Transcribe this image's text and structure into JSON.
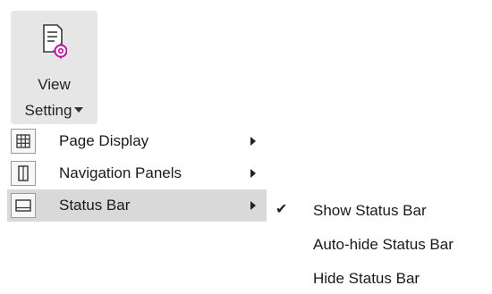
{
  "ribbon": {
    "view_setting": {
      "label_line1": "View",
      "label_line2": "Setting",
      "icon": "document-gear-icon",
      "accent_color": "#b5179e"
    }
  },
  "menu": {
    "items": [
      {
        "label": "Page Display",
        "icon": "grid-icon",
        "has_submenu": true
      },
      {
        "label": "Navigation Panels",
        "icon": "panel-icon",
        "has_submenu": true
      },
      {
        "label": "Status Bar",
        "icon": "status-bar-icon",
        "has_submenu": true,
        "highlighted": true
      }
    ]
  },
  "submenu": {
    "items": [
      {
        "label": "Show Status Bar",
        "checked": true,
        "check_glyph": "✔"
      },
      {
        "label": "Auto-hide Status Bar",
        "checked": false
      },
      {
        "label": "Hide Status Bar",
        "checked": false
      }
    ]
  },
  "colors": {
    "ribbon_pressed_bg": "#e6e6e6",
    "menu_hover_bg": "#d9d9d9"
  }
}
